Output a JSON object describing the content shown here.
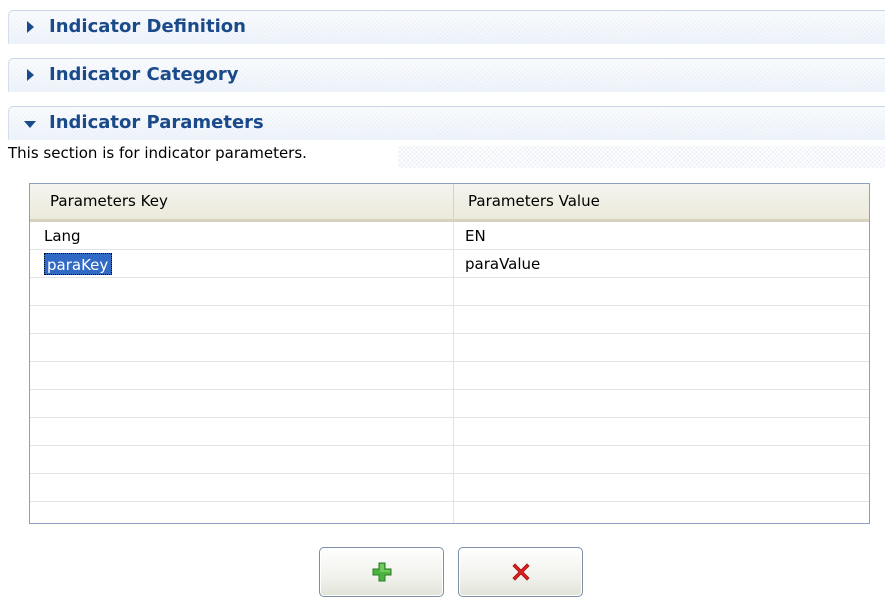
{
  "sections": [
    {
      "title": "Indicator Definition",
      "state": "collapsed"
    },
    {
      "title": "Indicator Category",
      "state": "collapsed"
    },
    {
      "title": "Indicator Parameters",
      "state": "expanded",
      "description": "This section is for indicator parameters."
    }
  ],
  "table": {
    "columns": [
      "Parameters Key",
      "Parameters Value"
    ],
    "rows": [
      {
        "key": "Lang",
        "value": "EN"
      },
      {
        "key": "paraKey",
        "value": "paraValue",
        "editing": true
      }
    ],
    "empty_rows": 8
  },
  "buttons": {
    "add_icon": "plus-icon",
    "remove_icon": "red-x-icon"
  },
  "colors": {
    "section_title": "#1a4a8a",
    "selection": "#316ac5",
    "add_icon": "#3aa633",
    "remove_icon": "#e02020"
  }
}
